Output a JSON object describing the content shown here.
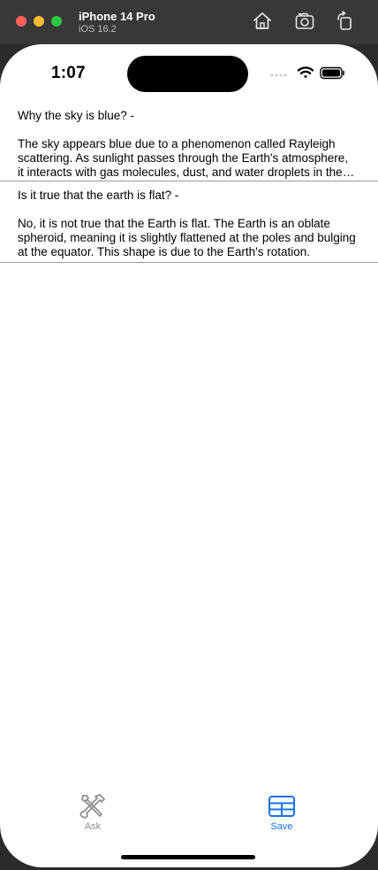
{
  "simulator": {
    "device_name": "iPhone 14 Pro",
    "os_version": "iOS 16.2",
    "icons": [
      "home-icon",
      "screenshot-icon",
      "rotate-icon"
    ]
  },
  "status_bar": {
    "time": "1:07",
    "icons": [
      "signal-icon",
      "wifi-icon",
      "battery-icon"
    ]
  },
  "list": {
    "items": [
      {
        "question": "Why the sky is blue? -",
        "answer": "The sky appears blue due to a phenomenon called Rayleigh scattering. As sunlight passes through the Earth's atmosphere, it interacts with gas molecules, dust, and water droplets in the air, scattering shorter blue wavelengths more than other colors."
      },
      {
        "question": "Is it true that the earth is flat? -",
        "answer": "No, it is not true that the Earth is flat. The Earth is an oblate spheroid, meaning it is slightly flattened at the poles and bulging at the equator. This shape is due to the Earth's rotation."
      }
    ]
  },
  "tabbar": {
    "ask_label": "Ask",
    "save_label": "Save",
    "ask_icon": "wrench-screwdriver-icon",
    "save_icon": "table-grid-icon",
    "selected": "save",
    "colors": {
      "selected": "#1a73e8",
      "unselected": "#8e8e93"
    }
  }
}
